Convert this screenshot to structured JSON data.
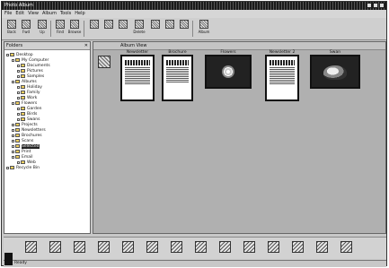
{
  "window": {
    "title": "Photo Album"
  },
  "menu": [
    "File",
    "Edit",
    "View",
    "Album",
    "Tools",
    "Help"
  ],
  "toolbar": {
    "buttons": [
      {
        "icon": "back-icon",
        "label": "Back"
      },
      {
        "icon": "forward-icon",
        "label": "Fwd"
      },
      {
        "icon": "up-icon",
        "label": "Up"
      },
      {
        "icon": "find-icon",
        "label": "Find"
      },
      {
        "icon": "browse-icon",
        "label": "Browse"
      },
      {
        "icon": "cut-icon",
        "label": ""
      },
      {
        "icon": "copy-icon",
        "label": ""
      },
      {
        "icon": "paste-icon",
        "label": ""
      },
      {
        "icon": "delete-icon",
        "label": "Delete"
      },
      {
        "icon": "rotate-icon",
        "label": ""
      },
      {
        "icon": "print-icon",
        "label": ""
      },
      {
        "icon": "slide-icon",
        "label": ""
      },
      {
        "icon": "album-icon",
        "label": "Album"
      }
    ]
  },
  "left_panel": {
    "title": "Folders",
    "tree": [
      {
        "label": "Desktop",
        "level": 0
      },
      {
        "label": "My Computer",
        "level": 1
      },
      {
        "label": "Documents",
        "level": 2
      },
      {
        "label": "Pictures",
        "level": 2
      },
      {
        "label": "Samples",
        "level": 2
      },
      {
        "label": "Albums",
        "level": 1
      },
      {
        "label": "Holiday",
        "level": 2
      },
      {
        "label": "Family",
        "level": 2
      },
      {
        "label": "Work",
        "level": 2
      },
      {
        "label": "Flowers",
        "level": 1
      },
      {
        "label": "Garden",
        "level": 2
      },
      {
        "label": "Birds",
        "level": 2
      },
      {
        "label": "Swans",
        "level": 2
      },
      {
        "label": "Projects",
        "level": 1
      },
      {
        "label": "Newsletters",
        "level": 1
      },
      {
        "label": "Brochures",
        "level": 1
      },
      {
        "label": "Scans",
        "level": 1
      },
      {
        "label": "Selected",
        "level": 1,
        "selected": true
      },
      {
        "label": "Print",
        "level": 1
      },
      {
        "label": "Email",
        "level": 1
      },
      {
        "label": "Web",
        "level": 2
      },
      {
        "label": "Recycle Bin",
        "level": 0
      }
    ]
  },
  "main": {
    "header": "Album View",
    "thumbnails": [
      {
        "caption": "Newsletter",
        "kind": "document"
      },
      {
        "caption": "Brochure",
        "kind": "document"
      },
      {
        "caption": "Flowers",
        "kind": "photo-flower"
      },
      {
        "caption": "Newsletter 2",
        "kind": "document"
      },
      {
        "caption": "Swan",
        "kind": "photo-swan"
      }
    ]
  },
  "dock": {
    "icons": [
      "scan-icon",
      "camera-icon",
      "photo-icon",
      "album-icon",
      "save-icon",
      "edit-icon",
      "paint-icon",
      "gallery-icon",
      "web-icon",
      "email-icon",
      "print-icon",
      "calendar-icon",
      "card-icon",
      "exit-icon"
    ]
  },
  "status": {
    "text": "Ready"
  }
}
